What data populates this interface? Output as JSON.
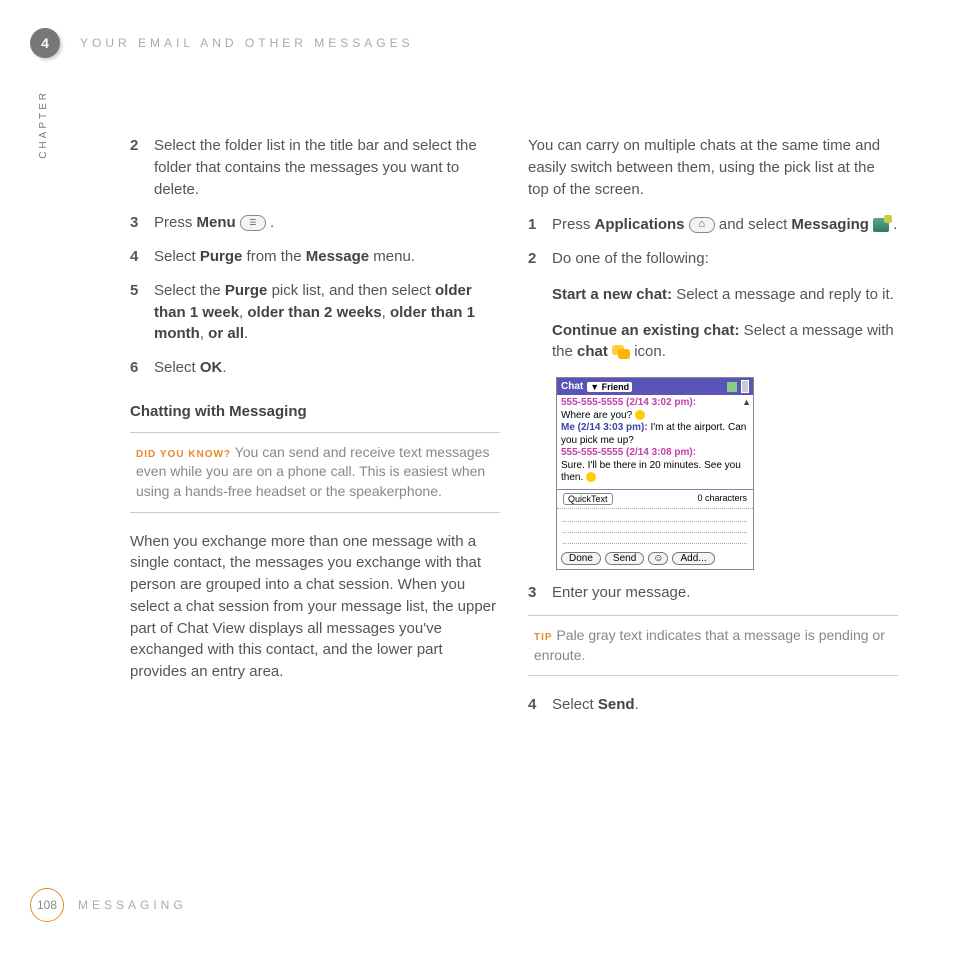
{
  "chapter_number": "4",
  "top_title": "YOUR EMAIL AND OTHER MESSAGES",
  "vert_label": "CHAPTER",
  "page_number": "108",
  "footer_title": "MESSAGING",
  "left": {
    "step2": {
      "num": "2",
      "text": "Select the folder list in the title bar and select the folder that contains the messages you want to delete."
    },
    "step3": {
      "num": "3",
      "pre": "Press ",
      "bold1": "Menu",
      "post": " ."
    },
    "step4": {
      "num": "4",
      "a": "Select ",
      "b": "Purge",
      "c": " from the ",
      "d": "Message",
      "e": " menu."
    },
    "step5": {
      "num": "5",
      "a": "Select the ",
      "b": "Purge",
      "c": " pick list, and then select ",
      "d": "older than 1 week",
      "e": ", ",
      "f": "older than 2 weeks",
      "g": ", ",
      "h": "older than 1 month",
      "i": ", ",
      "j": "or all",
      "k": "."
    },
    "step6": {
      "num": "6",
      "a": "Select ",
      "b": "OK",
      "c": "."
    },
    "subhead": "Chatting with Messaging",
    "dyk": {
      "tag": "DID YOU KNOW?",
      "text": "  You can send and receive text messages even while you are on a phone call. This is easiest when using a hands-free headset or the speakerphone."
    },
    "para": "When you exchange more than one message with a single contact, the messages you exchange with that person are grouped into a chat session. When you select a chat session from your message list, the upper part of Chat View displays all messages you've exchanged with this contact, and the lower part provides an entry area."
  },
  "right": {
    "intro": "You can carry on multiple chats at the same time and easily switch between them, using the pick list at the top of the screen.",
    "step1": {
      "num": "1",
      "a": "Press ",
      "b": "Applications",
      "c": " and select ",
      "d": "Messaging",
      "e": " ."
    },
    "step2": {
      "num": "2",
      "text": "Do one of the following:"
    },
    "start": {
      "label": "Start a new chat:",
      "text": " Select a message and reply to it."
    },
    "cont": {
      "label": "Continue an existing chat:",
      "text1": " Select a message with the ",
      "text2": "chat",
      "text3": " icon."
    },
    "shot": {
      "title": "Chat",
      "dropdown": "▼ Friend",
      "line1": "555-555-5555 (2/14 3:02 pm):",
      "line2": "Where are you? ",
      "line3a": "Me (2/14 3:03 pm):",
      "line3b": " I'm at the airport. Can you pick me up?",
      "line4": "555-555-5555 (2/14 3:08 pm):",
      "line5": "Sure. I'll be there in 20 minutes. See you then. ",
      "quicktext": "QuickText",
      "chars": "0 characters",
      "btn_done": "Done",
      "btn_send": "Send",
      "btn_add": "Add..."
    },
    "step3": {
      "num": "3",
      "text": "Enter your message."
    },
    "tip": {
      "tag": "TIP",
      "text": "  Pale gray text indicates that a message is pending or enroute."
    },
    "step4": {
      "num": "4",
      "a": "Select ",
      "b": "Send",
      "c": "."
    }
  }
}
